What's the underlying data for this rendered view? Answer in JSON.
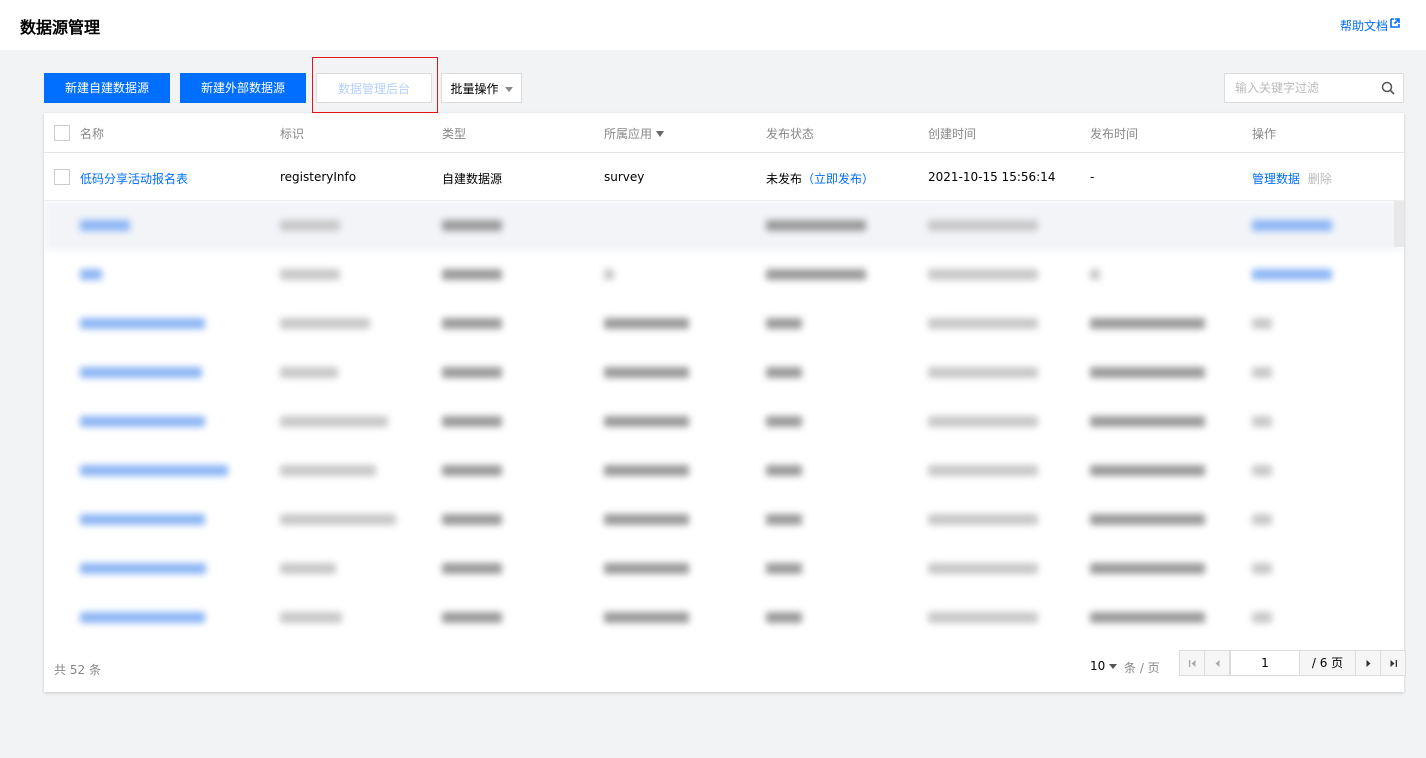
{
  "header": {
    "title": "数据源管理",
    "help_link": "帮助文档"
  },
  "toolbar": {
    "new_internal": "新建自建数据源",
    "new_external": "新建外部数据源",
    "admin_console": "数据管理后台",
    "batch_ops": "批量操作",
    "search_placeholder": "输入关键字过滤"
  },
  "table": {
    "columns": [
      "名称",
      "标识",
      "类型",
      "所属应用",
      "发布状态",
      "创建时间",
      "发布时间",
      "操作"
    ],
    "rows": [
      {
        "name": "低码分享活动报名表",
        "identifier": "registeryInfo",
        "type": "自建数据源",
        "app": "survey",
        "status": "未发布",
        "publish_action": "（立即发布）",
        "created": "2021-10-15 15:56:14",
        "published": "-",
        "manage": "管理数据",
        "delete": "删除"
      }
    ]
  },
  "footer": {
    "total_prefix": "共",
    "total_count": "52",
    "total_suffix": "条",
    "page_size": "10",
    "per_page": "条 / 页",
    "current_page": "1",
    "total_pages": "/ 6 页"
  },
  "colors": {
    "primary": "#006eff",
    "highlight": "#e5141c"
  }
}
